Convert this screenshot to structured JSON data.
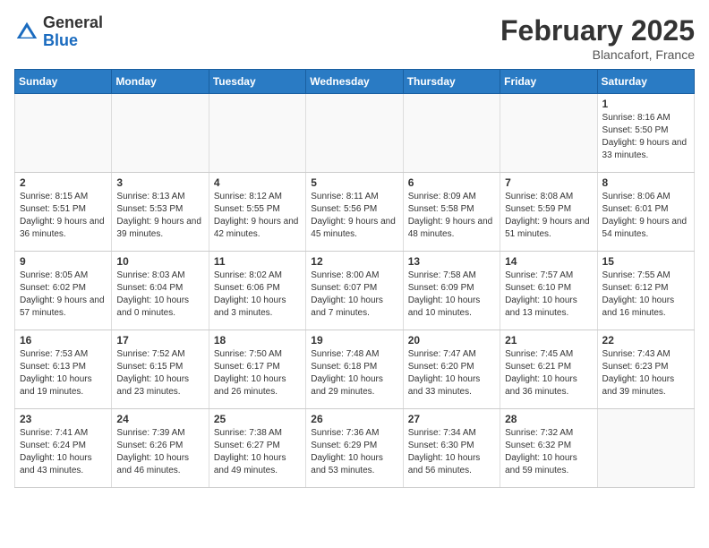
{
  "header": {
    "logo_general": "General",
    "logo_blue": "Blue",
    "month_title": "February 2025",
    "location": "Blancafort, France"
  },
  "days_of_week": [
    "Sunday",
    "Monday",
    "Tuesday",
    "Wednesday",
    "Thursday",
    "Friday",
    "Saturday"
  ],
  "weeks": [
    [
      {
        "day": "",
        "info": ""
      },
      {
        "day": "",
        "info": ""
      },
      {
        "day": "",
        "info": ""
      },
      {
        "day": "",
        "info": ""
      },
      {
        "day": "",
        "info": ""
      },
      {
        "day": "",
        "info": ""
      },
      {
        "day": "1",
        "info": "Sunrise: 8:16 AM\nSunset: 5:50 PM\nDaylight: 9 hours and 33 minutes."
      }
    ],
    [
      {
        "day": "2",
        "info": "Sunrise: 8:15 AM\nSunset: 5:51 PM\nDaylight: 9 hours and 36 minutes."
      },
      {
        "day": "3",
        "info": "Sunrise: 8:13 AM\nSunset: 5:53 PM\nDaylight: 9 hours and 39 minutes."
      },
      {
        "day": "4",
        "info": "Sunrise: 8:12 AM\nSunset: 5:55 PM\nDaylight: 9 hours and 42 minutes."
      },
      {
        "day": "5",
        "info": "Sunrise: 8:11 AM\nSunset: 5:56 PM\nDaylight: 9 hours and 45 minutes."
      },
      {
        "day": "6",
        "info": "Sunrise: 8:09 AM\nSunset: 5:58 PM\nDaylight: 9 hours and 48 minutes."
      },
      {
        "day": "7",
        "info": "Sunrise: 8:08 AM\nSunset: 5:59 PM\nDaylight: 9 hours and 51 minutes."
      },
      {
        "day": "8",
        "info": "Sunrise: 8:06 AM\nSunset: 6:01 PM\nDaylight: 9 hours and 54 minutes."
      }
    ],
    [
      {
        "day": "9",
        "info": "Sunrise: 8:05 AM\nSunset: 6:02 PM\nDaylight: 9 hours and 57 minutes."
      },
      {
        "day": "10",
        "info": "Sunrise: 8:03 AM\nSunset: 6:04 PM\nDaylight: 10 hours and 0 minutes."
      },
      {
        "day": "11",
        "info": "Sunrise: 8:02 AM\nSunset: 6:06 PM\nDaylight: 10 hours and 3 minutes."
      },
      {
        "day": "12",
        "info": "Sunrise: 8:00 AM\nSunset: 6:07 PM\nDaylight: 10 hours and 7 minutes."
      },
      {
        "day": "13",
        "info": "Sunrise: 7:58 AM\nSunset: 6:09 PM\nDaylight: 10 hours and 10 minutes."
      },
      {
        "day": "14",
        "info": "Sunrise: 7:57 AM\nSunset: 6:10 PM\nDaylight: 10 hours and 13 minutes."
      },
      {
        "day": "15",
        "info": "Sunrise: 7:55 AM\nSunset: 6:12 PM\nDaylight: 10 hours and 16 minutes."
      }
    ],
    [
      {
        "day": "16",
        "info": "Sunrise: 7:53 AM\nSunset: 6:13 PM\nDaylight: 10 hours and 19 minutes."
      },
      {
        "day": "17",
        "info": "Sunrise: 7:52 AM\nSunset: 6:15 PM\nDaylight: 10 hours and 23 minutes."
      },
      {
        "day": "18",
        "info": "Sunrise: 7:50 AM\nSunset: 6:17 PM\nDaylight: 10 hours and 26 minutes."
      },
      {
        "day": "19",
        "info": "Sunrise: 7:48 AM\nSunset: 6:18 PM\nDaylight: 10 hours and 29 minutes."
      },
      {
        "day": "20",
        "info": "Sunrise: 7:47 AM\nSunset: 6:20 PM\nDaylight: 10 hours and 33 minutes."
      },
      {
        "day": "21",
        "info": "Sunrise: 7:45 AM\nSunset: 6:21 PM\nDaylight: 10 hours and 36 minutes."
      },
      {
        "day": "22",
        "info": "Sunrise: 7:43 AM\nSunset: 6:23 PM\nDaylight: 10 hours and 39 minutes."
      }
    ],
    [
      {
        "day": "23",
        "info": "Sunrise: 7:41 AM\nSunset: 6:24 PM\nDaylight: 10 hours and 43 minutes."
      },
      {
        "day": "24",
        "info": "Sunrise: 7:39 AM\nSunset: 6:26 PM\nDaylight: 10 hours and 46 minutes."
      },
      {
        "day": "25",
        "info": "Sunrise: 7:38 AM\nSunset: 6:27 PM\nDaylight: 10 hours and 49 minutes."
      },
      {
        "day": "26",
        "info": "Sunrise: 7:36 AM\nSunset: 6:29 PM\nDaylight: 10 hours and 53 minutes."
      },
      {
        "day": "27",
        "info": "Sunrise: 7:34 AM\nSunset: 6:30 PM\nDaylight: 10 hours and 56 minutes."
      },
      {
        "day": "28",
        "info": "Sunrise: 7:32 AM\nSunset: 6:32 PM\nDaylight: 10 hours and 59 minutes."
      },
      {
        "day": "",
        "info": ""
      }
    ]
  ]
}
